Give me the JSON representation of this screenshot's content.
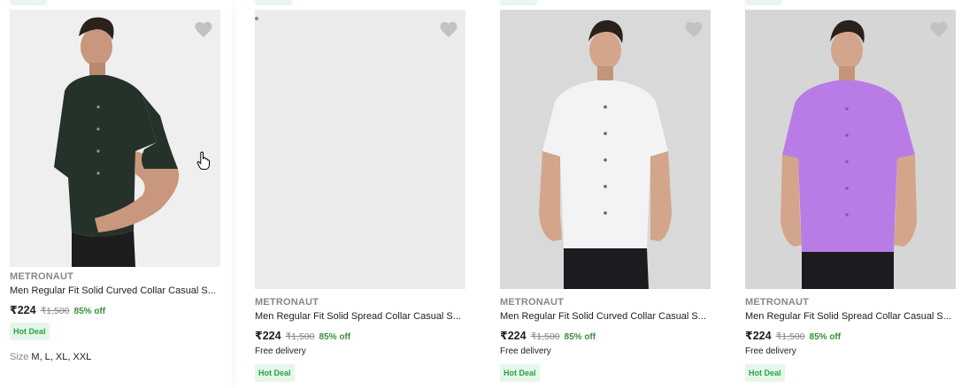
{
  "products": [
    {
      "brand": "METRONAUT",
      "title": "Men Regular Fit Solid Curved Collar Casual S...",
      "price": "₹224",
      "mrp": "₹1,500",
      "discount": "85% off",
      "delivery": "",
      "badge": "Hot Deal",
      "size_label": "Size",
      "sizes": "M, L, XL, XXL",
      "shirt_color": "#253229"
    },
    {
      "brand": "METRONAUT",
      "title": "Men Regular Fit Solid Spread Collar Casual S...",
      "price": "₹224",
      "mrp": "₹1,500",
      "discount": "85% off",
      "delivery": "Free delivery",
      "badge": "Hot Deal",
      "shirt_color": "#b3292c"
    },
    {
      "brand": "METRONAUT",
      "title": "Men Regular Fit Solid Curved Collar Casual S...",
      "price": "₹224",
      "mrp": "₹1,500",
      "discount": "85% off",
      "delivery": "Free delivery",
      "badge": "Hot Deal",
      "shirt_color": "#f3f3f6"
    },
    {
      "brand": "METRONAUT",
      "title": "Men Regular Fit Solid Spread Collar Casual S...",
      "price": "₹224",
      "mrp": "₹1,500",
      "discount": "85% off",
      "delivery": "Free delivery",
      "badge": "Hot Deal",
      "shirt_color": "#b97ce6"
    }
  ],
  "colors": {
    "discount": "#388e3c",
    "badge_text": "#26a541",
    "badge_bg": "#e5f7ea",
    "muted": "#878787",
    "heart": "#c2c2c2"
  },
  "icons": {
    "wishlist": "heart-icon",
    "cursor": "hand-pointer-icon"
  }
}
